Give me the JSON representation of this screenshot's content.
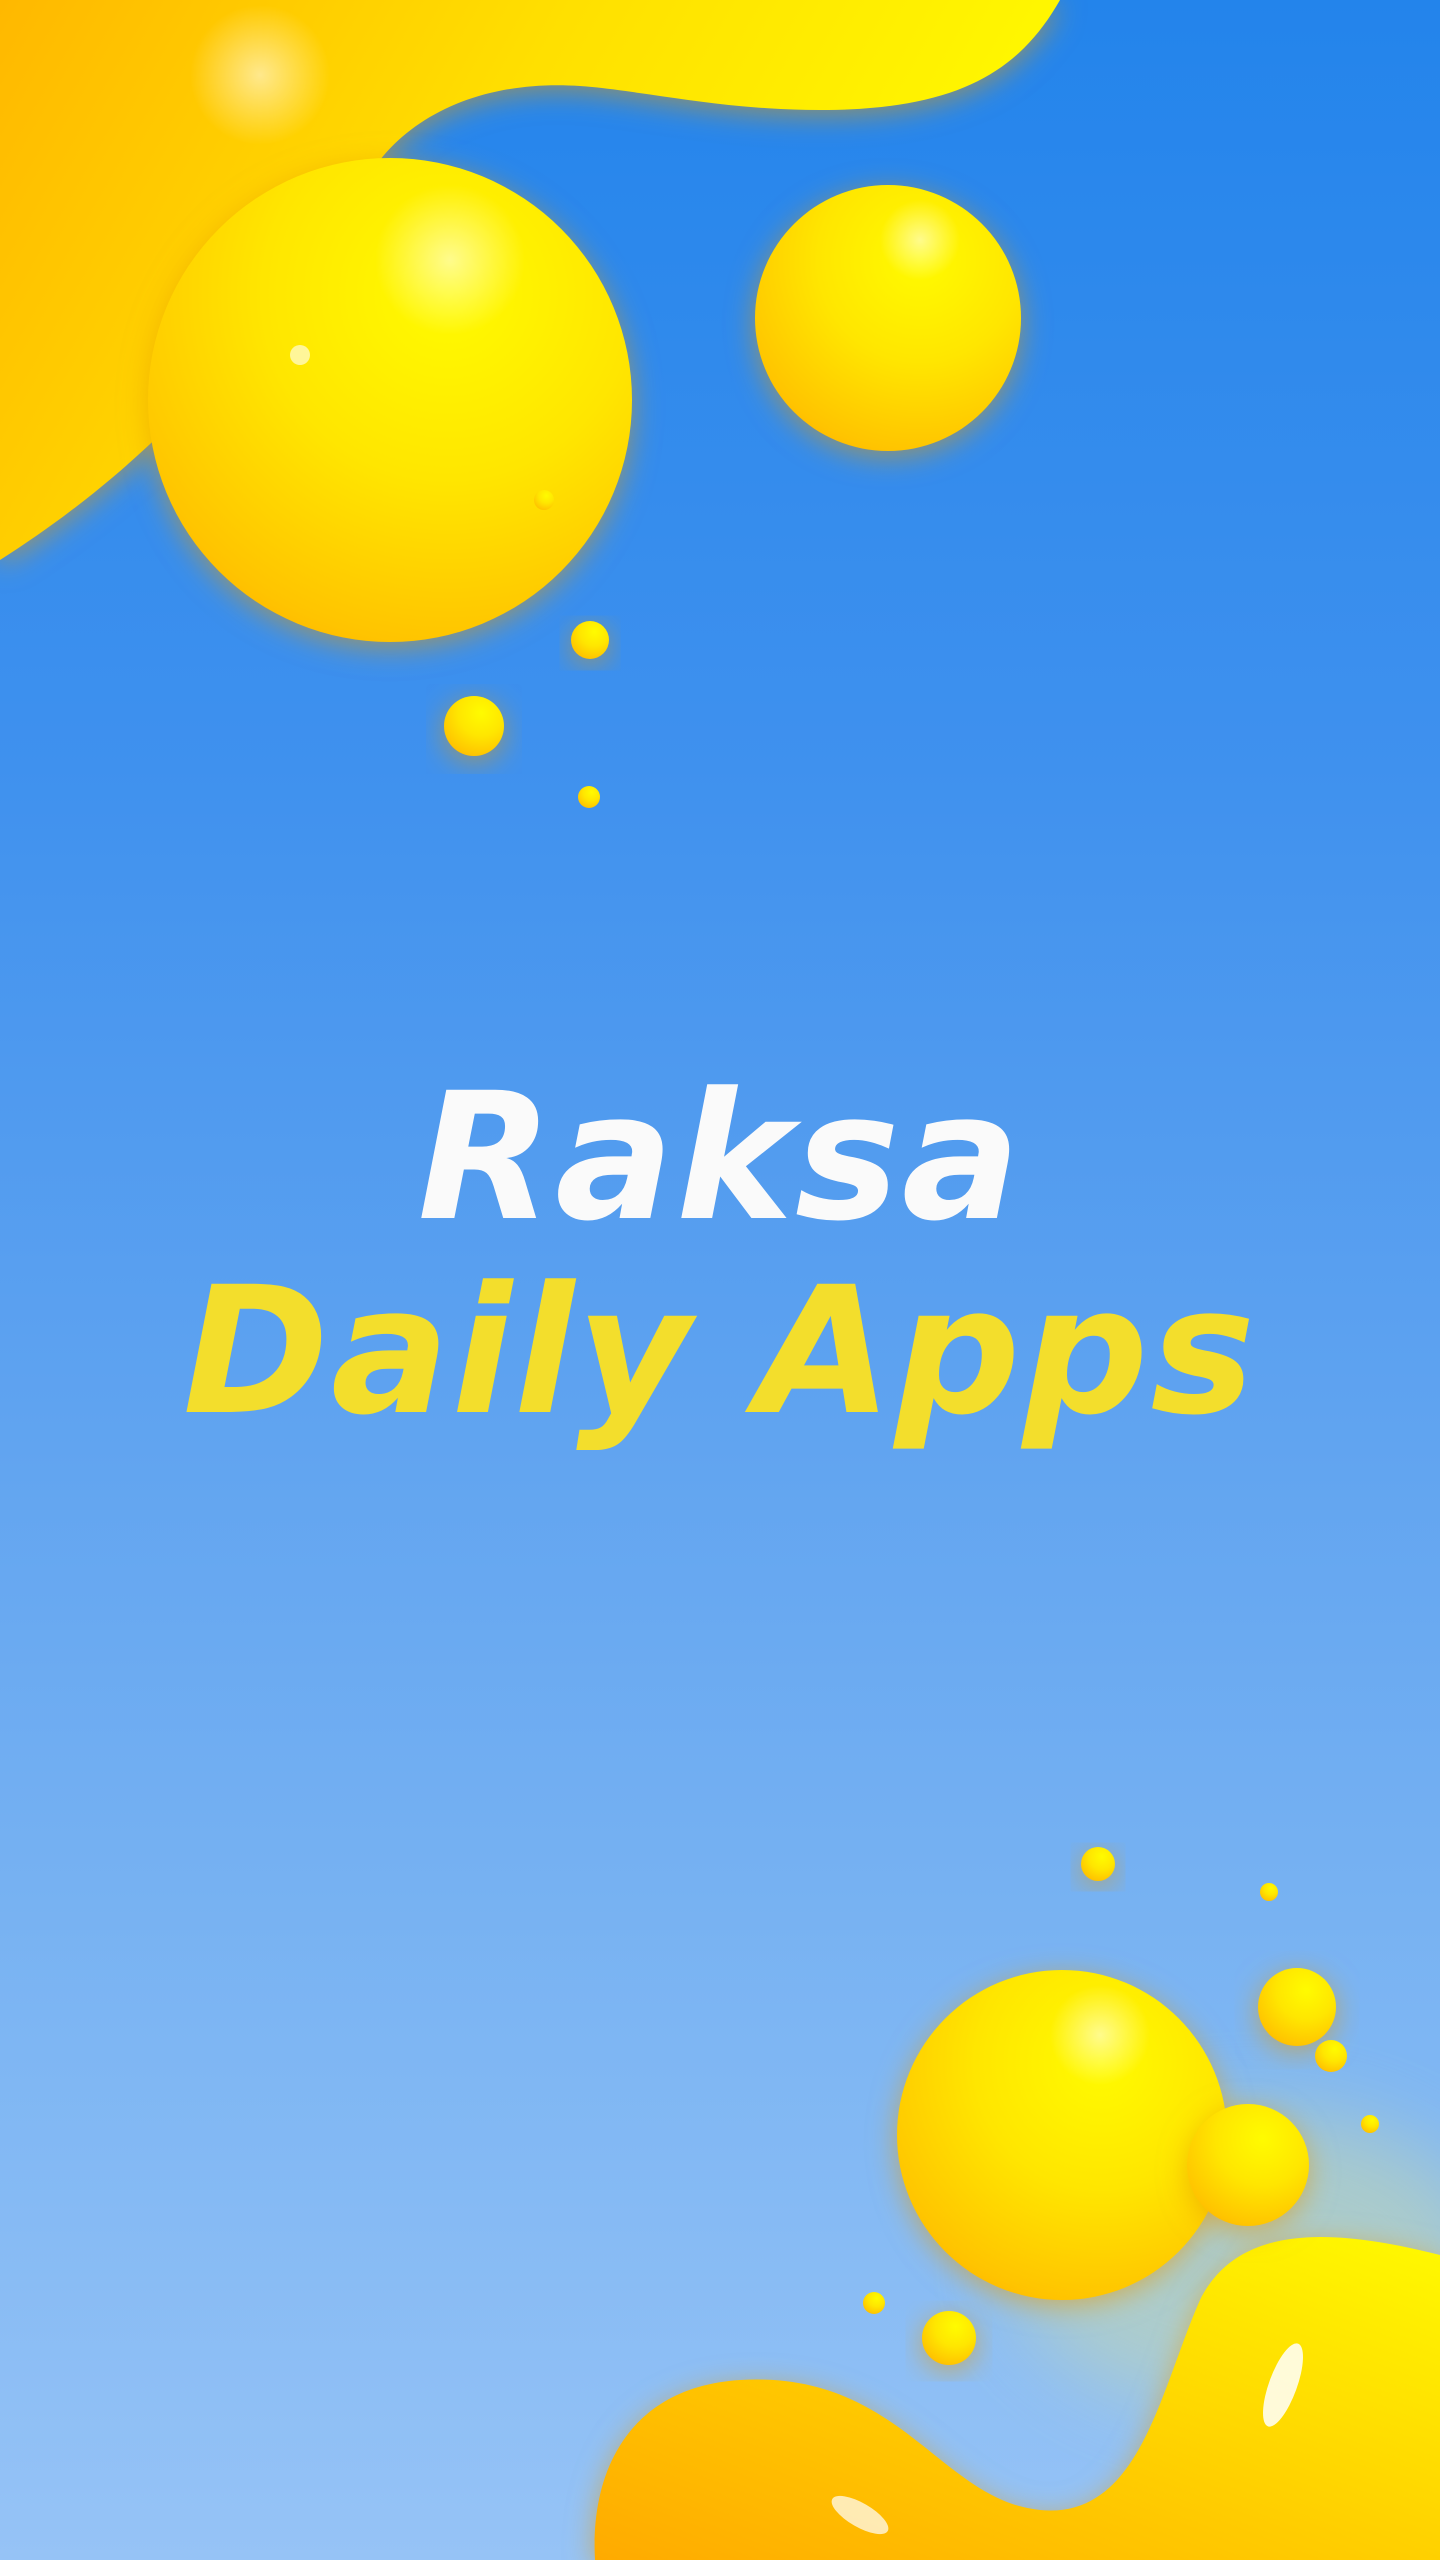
{
  "splash": {
    "title_line1": "Raksa",
    "title_line2": "Daily Apps"
  },
  "colors": {
    "background_top": "#2384EB",
    "background_bottom": "#96C3F6",
    "title_primary": "#FAFAFA",
    "title_accent": "#F3DE2C",
    "bubble_light": "#FFFB00",
    "bubble_dark": "#FFB000"
  }
}
